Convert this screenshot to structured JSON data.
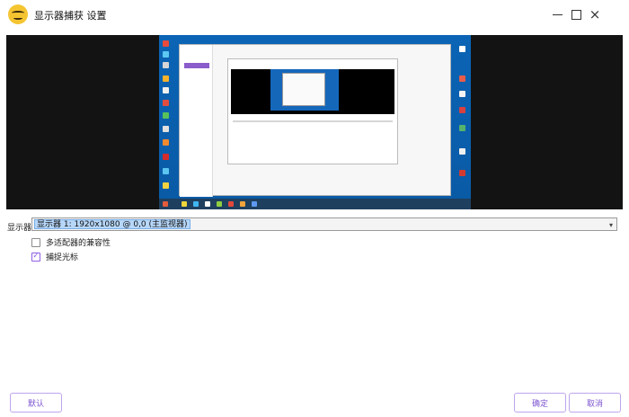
{
  "window": {
    "title": "显示器捕获 设置",
    "brand_color": "#f4c531",
    "icons": {
      "app": "bear-face-logo",
      "minimize": "minimize-icon",
      "maximize": "maximize-icon",
      "close": "close-icon"
    }
  },
  "preview": {
    "background": "#131313",
    "desktop_color": "#0b64b5"
  },
  "display": {
    "label": "显示器",
    "selected_value": "显示器 1: 1920x1080 @ 0,0 (主监视器)",
    "dropdown_icon": "chevron-down-icon"
  },
  "options": [
    {
      "label": "多适配器的兼容性",
      "checked": false
    },
    {
      "label": "捕捉光标",
      "checked": true
    }
  ],
  "buttons": {
    "default_label": "默认",
    "ok_label": "确定",
    "cancel_label": "取消",
    "accent_color": "#7d55d1"
  },
  "close_glyph": "×",
  "chevron_glyph": "▾",
  "check_glyph": "✓"
}
